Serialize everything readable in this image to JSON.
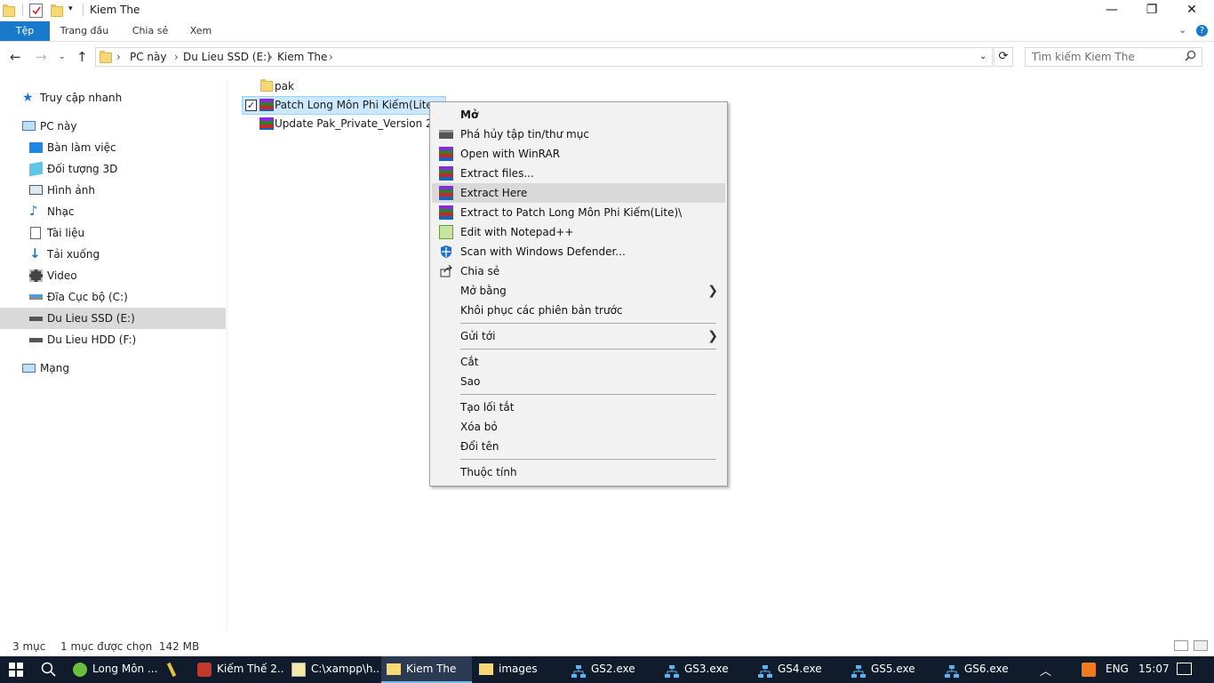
{
  "window": {
    "title": "Kiem The",
    "minimize_glyph": "—",
    "restore_glyph": "❐",
    "close_glyph": "✕"
  },
  "ribbon": {
    "tabs": [
      "Tệp",
      "Trang đầu",
      "Chia sẻ",
      "Xem"
    ],
    "accent": "#1979ca"
  },
  "address": {
    "crumbs": [
      "PC này",
      "Du Lieu SSD (E:)",
      "Kiem The"
    ],
    "search_placeholder": "Tìm kiếm Kiem The"
  },
  "nav_pane": {
    "quick_access": "Truy cập nhanh",
    "this_pc": "PC này",
    "items": [
      "Bàn làm việc",
      "Đối tượng 3D",
      "Hình ảnh",
      "Nhạc",
      "Tài liệu",
      "Tải xuống",
      "Video",
      "Đĩa Cục bộ (C:)",
      "Du Lieu SSD (E:)",
      "Du Lieu HDD (F:)"
    ],
    "selected": "Du Lieu SSD (E:)",
    "network": "Mạng"
  },
  "files": [
    {
      "name": "pak",
      "icon": "folder-icon",
      "selected": false,
      "checked": false
    },
    {
      "name": "Patch Long Môn Phi Kiếm(Lite).rar",
      "icon": "winrar-icon",
      "selected": true,
      "checked": true
    },
    {
      "name": "Update Pak_Private_Version 2019.rar",
      "icon": "winrar-icon",
      "selected": false,
      "checked": false
    }
  ],
  "context_menu": {
    "items": [
      {
        "label": "Mở",
        "bold": true,
        "icon": ""
      },
      {
        "label": "Phá hủy tập tin/thư mục",
        "icon": "shredder-icon"
      },
      {
        "label": "Open with WinRAR",
        "icon": "winrar-icon"
      },
      {
        "label": "Extract files...",
        "icon": "winrar-icon"
      },
      {
        "label": "Extract Here",
        "icon": "winrar-icon",
        "highlighted": true
      },
      {
        "label": "Extract to Patch Long Môn Phi Kiếm(Lite)\\",
        "icon": "winrar-icon"
      },
      {
        "label": "Edit with Notepad++",
        "icon": "notepadpp-icon"
      },
      {
        "label": "Scan with Windows Defender...",
        "icon": "defender-icon"
      },
      {
        "label": "Chia sẻ",
        "icon": "share-icon"
      },
      {
        "label": "Mở bằng",
        "icon": "",
        "submenu": true
      },
      {
        "label": "Khôi phục các phiên bản trước",
        "icon": ""
      },
      {
        "label": "Gửi tới",
        "icon": "",
        "submenu": true
      },
      {
        "label": "Cắt",
        "icon": ""
      },
      {
        "label": "Sao",
        "icon": ""
      },
      {
        "label": "Tạo lối tắt",
        "icon": ""
      },
      {
        "label": "Xóa bỏ",
        "icon": ""
      },
      {
        "label": "Đổi tên",
        "icon": ""
      },
      {
        "label": "Thuộc tính",
        "icon": ""
      }
    ],
    "submenu_glyph": "❯"
  },
  "status": {
    "count": "3 mục",
    "selection": "1 mục được chọn  142 MB"
  },
  "taskbar": {
    "apps": [
      {
        "label": "Long Môn ...",
        "icon": "game-icon"
      },
      {
        "label": "",
        "icon": "pen-icon"
      },
      {
        "label": "Kiếm Thế 2...",
        "icon": "game-logo-icon"
      },
      {
        "label": "C:\\xampp\\h...",
        "icon": "notepad-icon"
      },
      {
        "label": "Kiem The",
        "icon": "folder-icon",
        "active": true
      },
      {
        "label": "images",
        "icon": "folder-icon"
      },
      {
        "label": "GS2.exe",
        "icon": "network-icon"
      },
      {
        "label": "GS3.exe",
        "icon": "network-icon"
      },
      {
        "label": "GS4.exe",
        "icon": "network-icon"
      },
      {
        "label": "GS5.exe",
        "icon": "network-icon"
      },
      {
        "label": "GS6.exe",
        "icon": "network-icon"
      }
    ],
    "language": "ENG",
    "time": "15:07",
    "background": "#101c2c"
  }
}
